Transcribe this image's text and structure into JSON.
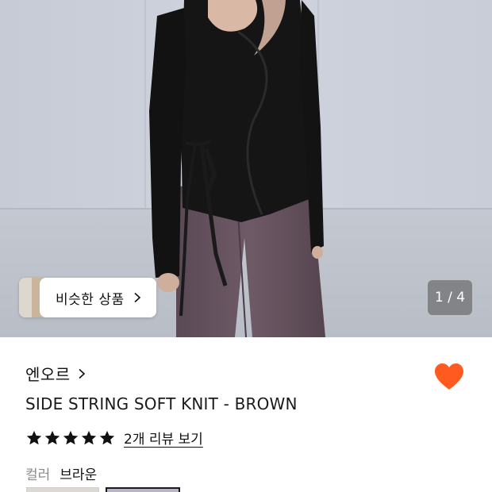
{
  "gallery": {
    "current": 1,
    "total": 4,
    "counter_text": "1 / 4",
    "similar_label": "비슷한 상품"
  },
  "product": {
    "brand": "엔오르",
    "title": "SIDE STRING SOFT KNIT - BROWN",
    "rating": 5,
    "review_link": "2개 리뷰 보기",
    "favorited": true,
    "option_label": "컬러",
    "option_value": "브라운"
  },
  "colors": {
    "heart": "#ff5a1f",
    "star": "#111111",
    "text": "#111111",
    "muted": "#8a8a8a"
  },
  "icons": {
    "similar_chevron": "chevron-right-icon",
    "brand_chevron": "chevron-right-icon",
    "favorite": "heart-filled-icon",
    "rating": "star-filled-icon"
  }
}
